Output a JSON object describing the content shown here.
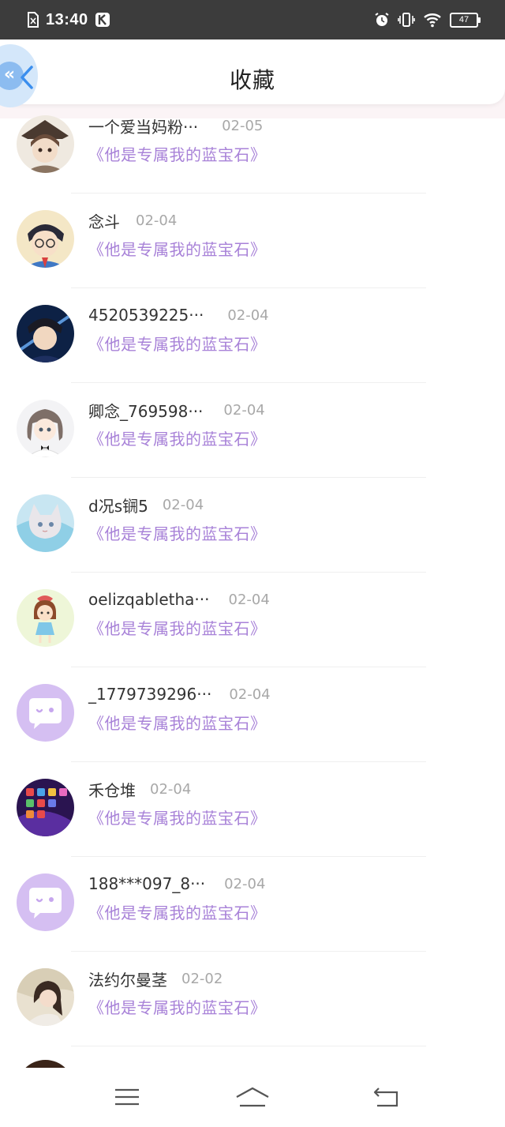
{
  "status_bar": {
    "time": "13:40",
    "battery": "47",
    "icons": [
      "sim-card-icon",
      "k-app-icon",
      "alarm-icon",
      "vibrate-icon",
      "wifi-icon",
      "battery-icon"
    ]
  },
  "header": {
    "title": "收藏",
    "back_icon": "chevron-left-icon"
  },
  "colors": {
    "accent": "#a882d8",
    "nickname": "#333333",
    "date": "#a8a8a8",
    "status_bar": "#3c3c3c",
    "default_avatar": "#d5bff2"
  },
  "favorites": [
    {
      "nickname": "一个爱当妈粉···",
      "date": "02-05",
      "work": "《他是专属我的蓝宝石》",
      "avatar": "anime-avatar"
    },
    {
      "nickname": "念斗",
      "date": "02-04",
      "work": "《他是专属我的蓝宝石》",
      "avatar": "anime-avatar"
    },
    {
      "nickname": "4520539225···",
      "date": "02-04",
      "work": "《他是专属我的蓝宝石》",
      "avatar": "anime-avatar"
    },
    {
      "nickname": "卿念_769598···",
      "date": "02-04",
      "work": "《他是专属我的蓝宝石》",
      "avatar": "anime-avatar"
    },
    {
      "nickname": "d况s锎5",
      "date": "02-04",
      "work": "《他是专属我的蓝宝石》",
      "avatar": "anime-avatar"
    },
    {
      "nickname": "oelizqabletha···",
      "date": "02-04",
      "work": "《他是专属我的蓝宝石》",
      "avatar": "cartoon-girl-avatar"
    },
    {
      "nickname": "_1779739296···",
      "date": "02-04",
      "work": "《他是专属我的蓝宝石》",
      "avatar": "default-chat-avatar"
    },
    {
      "nickname": "禾仓堆",
      "date": "02-04",
      "work": "《他是专属我的蓝宝石》",
      "avatar": "phone-screen-avatar"
    },
    {
      "nickname": "188***097_8···",
      "date": "02-04",
      "work": "《他是专属我的蓝宝石》",
      "avatar": "default-chat-avatar"
    },
    {
      "nickname": "法约尔曼茎",
      "date": "02-02",
      "work": "《他是专属我的蓝宝石》",
      "avatar": "photo-avatar"
    }
  ],
  "nav_bar": {
    "icons": [
      "menu-icon",
      "home-icon",
      "back-icon"
    ]
  }
}
